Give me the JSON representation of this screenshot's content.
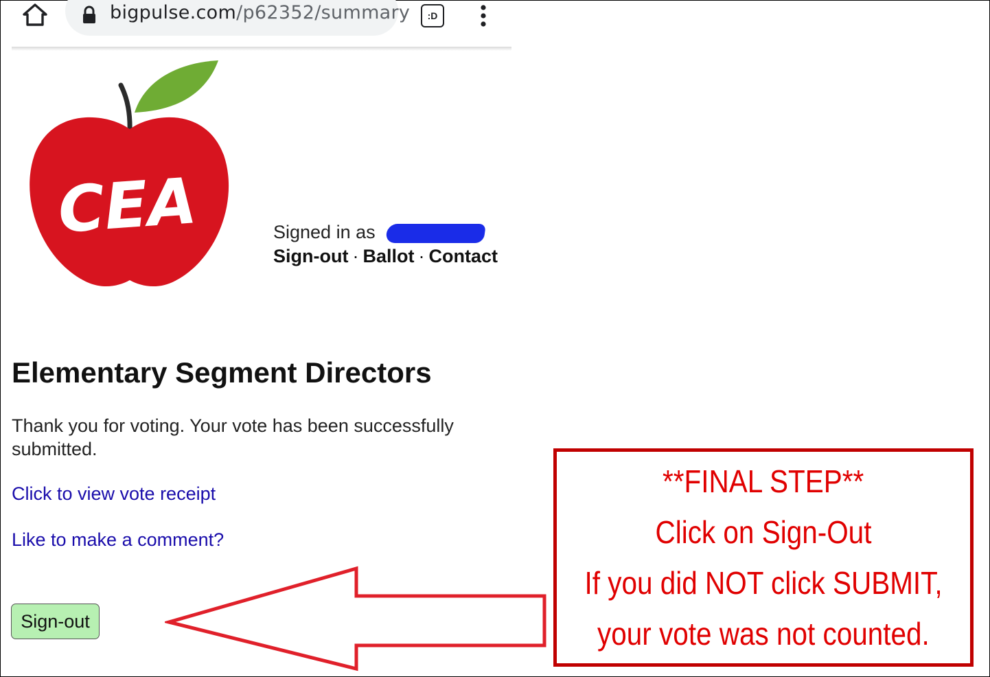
{
  "browser": {
    "url_domain": "bigpulse.com",
    "url_path": "/p62352/summary",
    "home_icon": "home-icon",
    "lock_icon": "lock-icon",
    "tab_icon": "tab-switcher-icon",
    "tab_icon_glyph": ":D",
    "menu_icon": "kebab-menu-icon"
  },
  "logo": {
    "text": "CEA",
    "colors": {
      "apple": "#d7141f",
      "leaf": "#6fac34",
      "stem": "#2b2b2b"
    }
  },
  "account": {
    "signed_in_prefix": "Signed in as",
    "nav": [
      "Sign-out",
      "Ballot",
      "Contact"
    ],
    "separator": "·"
  },
  "main": {
    "title": "Elementary Segment Directors",
    "thanks": "Thank you for voting. Your vote has been successfully submitted.",
    "receipt_link": "Click to view vote receipt",
    "comment_link": "Like to make a comment?",
    "signout_button": "Sign-out"
  },
  "callout": {
    "lines": [
      "**FINAL STEP**",
      "Click on Sign-Out",
      "If you did NOT click SUBMIT,",
      "your vote was not counted."
    ],
    "color": "#e00000",
    "border_color": "#c00000"
  },
  "colors": {
    "link": "#1a0dab",
    "button_bg": "#b7f0b2",
    "redaction": "#1a2ce8",
    "arrow_stroke": "#e0202a"
  }
}
